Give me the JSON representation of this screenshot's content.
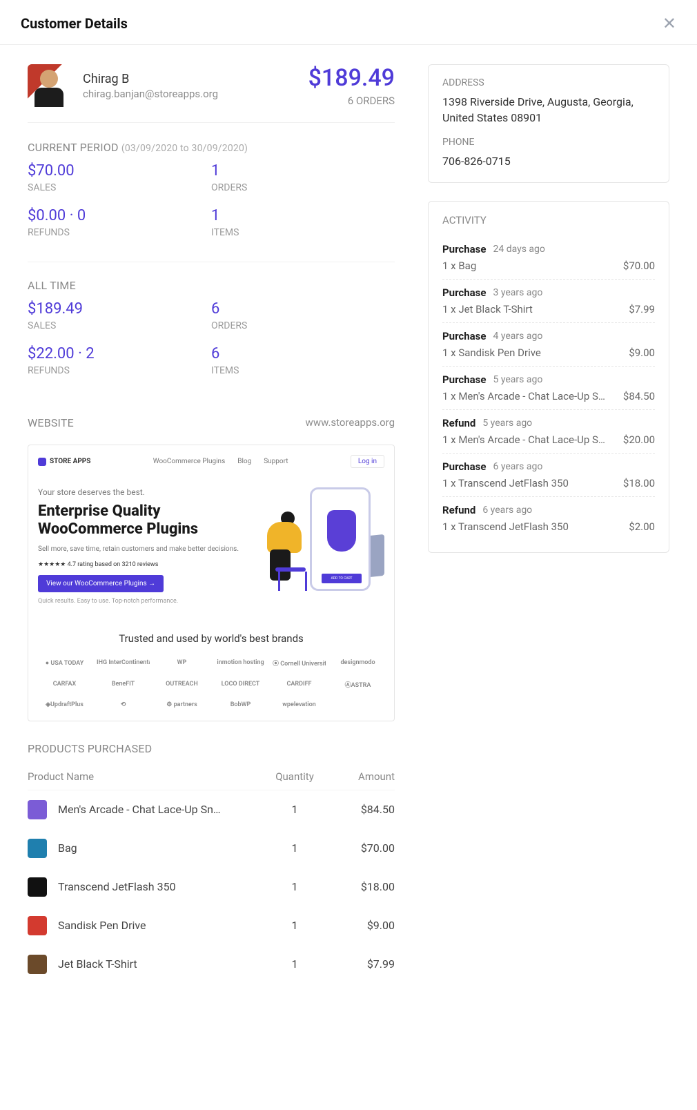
{
  "header": {
    "title": "Customer Details"
  },
  "customer": {
    "name": "Chirag B",
    "email": "chirag.banjan@storeapps.org",
    "total": "$189.49",
    "order_count": "6 ORDERS"
  },
  "current": {
    "label": "CURRENT PERIOD",
    "range": "(03/09/2020 to 30/09/2020)",
    "sales_val": "$70.00",
    "sales_lbl": "SALES",
    "orders_val": "1",
    "orders_lbl": "ORDERS",
    "refunds_val": "$0.00  ·  0",
    "refunds_lbl": "REFUNDS",
    "items_val": "1",
    "items_lbl": "ITEMS"
  },
  "alltime": {
    "label": "ALL TIME",
    "sales_val": "$189.49",
    "sales_lbl": "SALES",
    "orders_val": "6",
    "orders_lbl": "ORDERS",
    "refunds_val": "$22.00  ·  2",
    "refunds_lbl": "REFUNDS",
    "items_val": "6",
    "items_lbl": "ITEMS"
  },
  "website": {
    "label": "WEBSITE",
    "url": "www.storeapps.org",
    "brand": "STORE APPS",
    "nav1": "WooCommerce Plugins",
    "nav2": "Blog",
    "nav3": "Support",
    "login": "Log in",
    "tag": "Your store deserves the best.",
    "headline": "Enterprise Quality WooCommerce Plugins",
    "sub": "Sell more, save time, retain customers and make better decisions.",
    "rating": "★★★★★   4.7 rating based on 3210 reviews",
    "btn": "View our WooCommerce Plugins →",
    "note": "Quick results. Easy to use. Top-notch performance.",
    "cart": "ADD TO CART",
    "trusted": "Trusted and used by world's best brands",
    "logos": [
      "● USA TODAY",
      "IHG InterContinental",
      "WP",
      "inmotion hosting",
      "⦿ Cornell University",
      "designmodo",
      "CARFAX",
      "BeneFIT",
      "OUTREACH",
      "LOCO DIRECT",
      "CARDIFF",
      "ⒶASTRA",
      "◈UpdraftPlus",
      "⟲",
      "⚙ partners",
      "BobWP",
      "wpelevation"
    ]
  },
  "address": {
    "addr_lbl": "ADDRESS",
    "addr_val": "1398 Riverside Drive, Augusta, Georgia, United States 08901",
    "phone_lbl": "PHONE",
    "phone_val": "706-826-0715"
  },
  "activity": {
    "label": "ACTIVITY",
    "items": [
      {
        "type": "Purchase",
        "date": "24 days ago",
        "desc": "1 x Bag",
        "amt": "$70.00"
      },
      {
        "type": "Purchase",
        "date": "3 years ago",
        "desc": "1 x Jet Black T-Shirt",
        "amt": "$7.99"
      },
      {
        "type": "Purchase",
        "date": "4 years ago",
        "desc": "1 x Sandisk Pen Drive",
        "amt": "$9.00"
      },
      {
        "type": "Purchase",
        "date": "5 years ago",
        "desc": "1 x Men's Arcade - Chat Lace-Up S…",
        "amt": "$84.50"
      },
      {
        "type": "Refund",
        "date": "5 years ago",
        "desc": "1 x Men's Arcade - Chat Lace-Up S…",
        "amt": "$20.00"
      },
      {
        "type": "Purchase",
        "date": "6 years ago",
        "desc": "1 x Transcend JetFlash 350",
        "amt": "$18.00"
      },
      {
        "type": "Refund",
        "date": "6 years ago",
        "desc": "1 x Transcend JetFlash 350",
        "amt": "$2.00"
      }
    ]
  },
  "products": {
    "label": "PRODUCTS PURCHASED",
    "h_name": "Product Name",
    "h_qty": "Quantity",
    "h_amt": "Amount",
    "items": [
      {
        "color": "#7b5cd6",
        "name": "Men's Arcade - Chat Lace-Up Sn…",
        "qty": "1",
        "amt": "$84.50"
      },
      {
        "color": "#1f7fae",
        "name": "Bag",
        "qty": "1",
        "amt": "$70.00"
      },
      {
        "color": "#111111",
        "name": "Transcend JetFlash 350",
        "qty": "1",
        "amt": "$18.00"
      },
      {
        "color": "#d33a2f",
        "name": "Sandisk Pen Drive",
        "qty": "1",
        "amt": "$9.00"
      },
      {
        "color": "#6b4a2a",
        "name": "Jet Black T-Shirt",
        "qty": "1",
        "amt": "$7.99"
      }
    ]
  }
}
